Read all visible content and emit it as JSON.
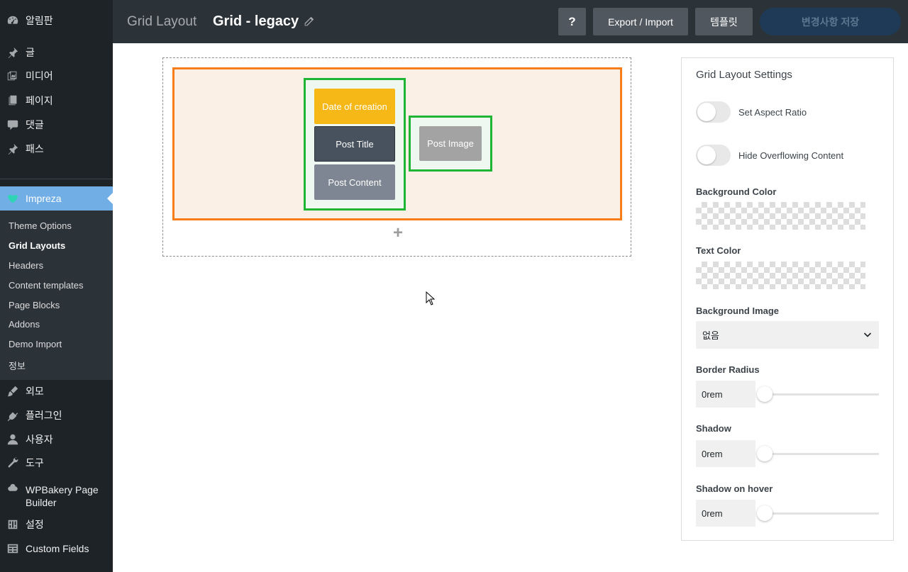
{
  "sidebar": {
    "top_items": [
      {
        "label": "알림판",
        "icon": "dashboard-icon"
      },
      {
        "label": "글",
        "icon": "pin-icon"
      },
      {
        "label": "미디어",
        "icon": "media-icon"
      },
      {
        "label": "페이지",
        "icon": "page-icon"
      },
      {
        "label": "댓글",
        "icon": "comment-icon"
      },
      {
        "label": "패스",
        "icon": "pin-icon"
      }
    ],
    "active_item": {
      "label": "Impreza",
      "icon": "impreza-logo-icon"
    },
    "submenu": [
      {
        "label": "Theme Options"
      },
      {
        "label": "Grid Layouts",
        "active": true
      },
      {
        "label": "Headers"
      },
      {
        "label": "Content templates"
      },
      {
        "label": "Page Blocks"
      },
      {
        "label": "Addons"
      },
      {
        "label": "Demo Import"
      },
      {
        "label": "정보"
      }
    ],
    "bottom_items": [
      {
        "label": "외모",
        "icon": "brush-icon"
      },
      {
        "label": "플러그인",
        "icon": "plugin-icon"
      },
      {
        "label": "사용자",
        "icon": "user-icon"
      },
      {
        "label": "도구",
        "icon": "wrench-icon"
      },
      {
        "label": "WPBakery Page Builder",
        "icon": "wpbakery-icon"
      },
      {
        "label": "설정",
        "icon": "settings-icon"
      },
      {
        "label": "Custom Fields",
        "icon": "fields-icon"
      }
    ]
  },
  "header": {
    "crumb": "Grid Layout",
    "grid_name": "Grid - legacy",
    "help_label": "?",
    "export_label": "Export / Import",
    "template_label": "템플릿",
    "save_label": "변경사항 저장"
  },
  "canvas": {
    "elements": {
      "date": "Date of creation",
      "title": "Post Title",
      "content": "Post Content",
      "image": "Post Image"
    },
    "add_row": "+"
  },
  "panel": {
    "title": "Grid Layout Settings",
    "toggles": [
      {
        "label": "Set Aspect Ratio",
        "on": false
      },
      {
        "label": "Hide Overflowing Content",
        "on": false
      }
    ],
    "background_color_label": "Background Color",
    "text_color_label": "Text Color",
    "background_image_label": "Background Image",
    "background_image_value": "없음",
    "border_radius_label": "Border Radius",
    "border_radius_value": "0rem",
    "shadow_label": "Shadow",
    "shadow_value": "0rem",
    "shadow_hover_label": "Shadow on hover",
    "shadow_hover_value": "0rem"
  },
  "colors": {
    "accent": "#72aee6",
    "row_border": "#f77c1a",
    "column_border": "#1fb534",
    "date_element": "#f6b817",
    "title_element": "#48525e",
    "content_element": "#7d8692",
    "image_element": "#a3a3a3"
  }
}
